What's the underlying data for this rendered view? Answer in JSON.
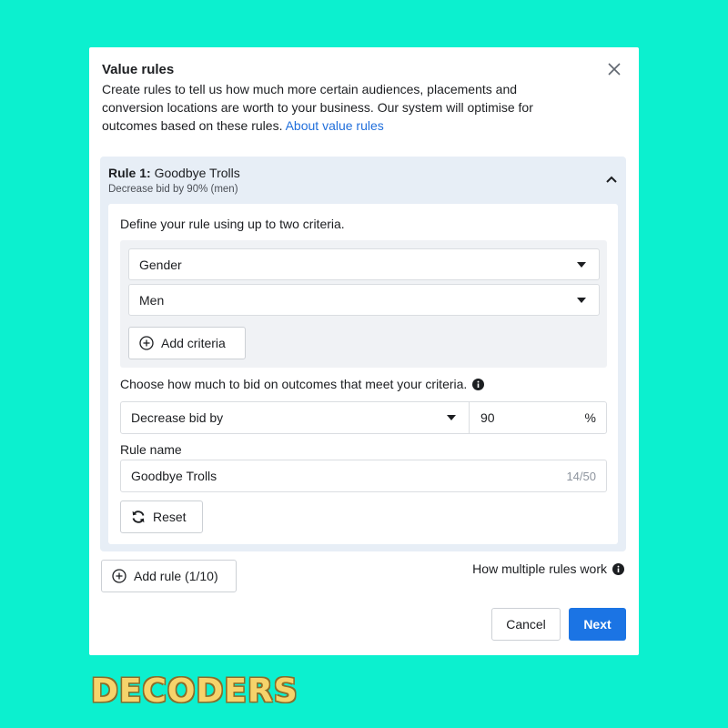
{
  "dialog": {
    "title": "Value rules",
    "description": "Create rules to tell us how much more certain audiences, placements and conversion locations are worth to your business. Our system will optimise for outcomes based on these rules.",
    "about_link": "About value rules",
    "close_icon": "close-icon"
  },
  "rule": {
    "prefix": "Rule 1:",
    "name": "Goodbye Trolls",
    "summary": "Decrease bid by 90% (men)",
    "define_label": "Define your rule using up to two criteria.",
    "criteria": [
      {
        "value": "Gender"
      },
      {
        "value": "Men"
      }
    ],
    "add_criteria_label": "Add criteria",
    "bid_label": "Choose how much to bid on outcomes that meet your criteria.",
    "bid_type": "Decrease bid by",
    "bid_amount": "90",
    "bid_unit": "%",
    "name_label": "Rule name",
    "name_value": "Goodbye Trolls",
    "name_count": "14/50",
    "reset_label": "Reset"
  },
  "footer": {
    "add_rule_label": "Add rule (1/10)",
    "how_rules_label": "How multiple rules work",
    "cancel_label": "Cancel",
    "next_label": "Next"
  },
  "brand": "DECODERS",
  "colors": {
    "background": "#0cf0cf",
    "primary": "#1b74e4",
    "link": "#216fdb",
    "panel": "#e7eef6"
  }
}
